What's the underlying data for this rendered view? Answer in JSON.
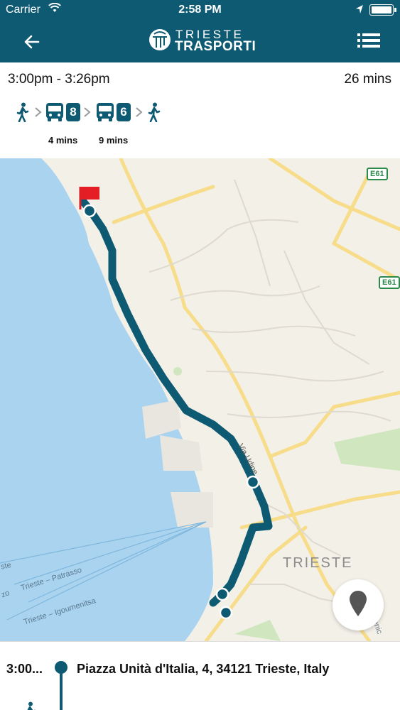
{
  "status_bar": {
    "carrier": "Carrier",
    "time": "2:58 PM"
  },
  "nav": {
    "back_icon": "back-arrow-icon",
    "logo_top": "TRIESTE",
    "logo_bottom": "TRASPORTI",
    "menu_icon": "list-menu-icon"
  },
  "trip": {
    "time_range": "3:00pm - 3:26pm",
    "duration": "26 mins",
    "legs": [
      {
        "mode": "walk",
        "icon": "walk-icon"
      },
      {
        "mode": "bus",
        "icon": "bus-icon",
        "route": "8",
        "duration": "4 mins"
      },
      {
        "mode": "bus",
        "icon": "bus-icon",
        "route": "6",
        "duration": "9 mins"
      },
      {
        "mode": "walk",
        "icon": "walk-icon"
      }
    ]
  },
  "map": {
    "city_label": "TRIESTE",
    "street_label": "Via Udine",
    "highway_badges": [
      "E61",
      "E61"
    ],
    "ferry_labels": [
      "Trieste – Patrasso",
      "Trieste – Igoumenitsa",
      "ste",
      "zo",
      "menic"
    ],
    "route_color": "#0e5a73",
    "water_color": "#aad3f0",
    "land_color": "#f3f0e8",
    "road_color": "#f7dc8a",
    "locate_button_icon": "map-pin-icon"
  },
  "itinerary": {
    "steps": [
      {
        "time": "3:00...",
        "place": "Piazza Unità d'Italia, 4, 34121 Trieste, Italy",
        "icon": "walk-icon"
      }
    ]
  }
}
